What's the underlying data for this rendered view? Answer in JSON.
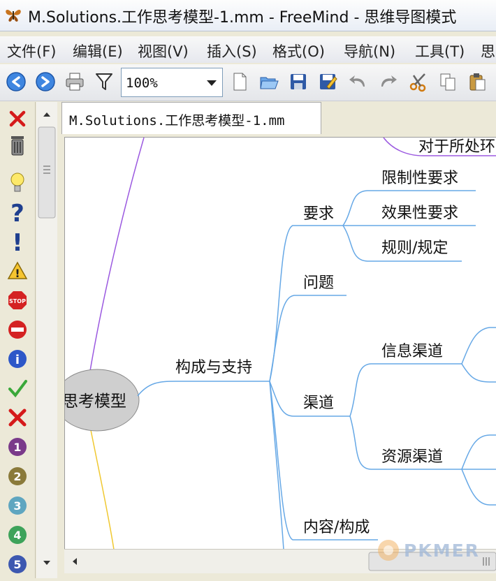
{
  "window": {
    "title": "M.Solutions.工作思考模型-1.mm - FreeMind - 思维导图模式"
  },
  "menu": [
    "文件(F)",
    "编辑(E)",
    "视图(V)",
    "插入(S)",
    "格式(O)",
    "导航(N)",
    "工具(T)",
    "思"
  ],
  "toolbar": {
    "zoom_value": "100%"
  },
  "left_icons": [
    "remove-all-icons-icon",
    "trash-icon",
    "idea-bulb-icon",
    "question-icon",
    "important-exclamation-icon",
    "warning-icon",
    "stop-sign-icon",
    "no-entry-icon",
    "info-icon",
    "checkmark-icon",
    "cross-icon",
    "priority-1-icon",
    "priority-2-icon",
    "priority-3-icon",
    "priority-4-icon",
    "priority-5-icon"
  ],
  "tab": {
    "label": "M.Solutions.工作思考模型-1.mm"
  },
  "mindmap": {
    "root": "思考模型",
    "top_partial": "对于所处环",
    "nodes": {
      "support": "构成与支持",
      "requirement": "要求",
      "req_limit": "限制性要求",
      "req_effect": "效果性要求",
      "req_rules": "规则/规定",
      "question": "问题",
      "channel": "渠道",
      "info_channel": "信息渠道",
      "resource_channel": "资源渠道",
      "content": "内容/构成"
    }
  },
  "watermark": "PKMER",
  "colors": {
    "branch_blue": "#66a8e6",
    "branch_purple": "#9b59e0",
    "branch_yellow": "#f0c830",
    "root_fill": "#cfcfcf"
  }
}
